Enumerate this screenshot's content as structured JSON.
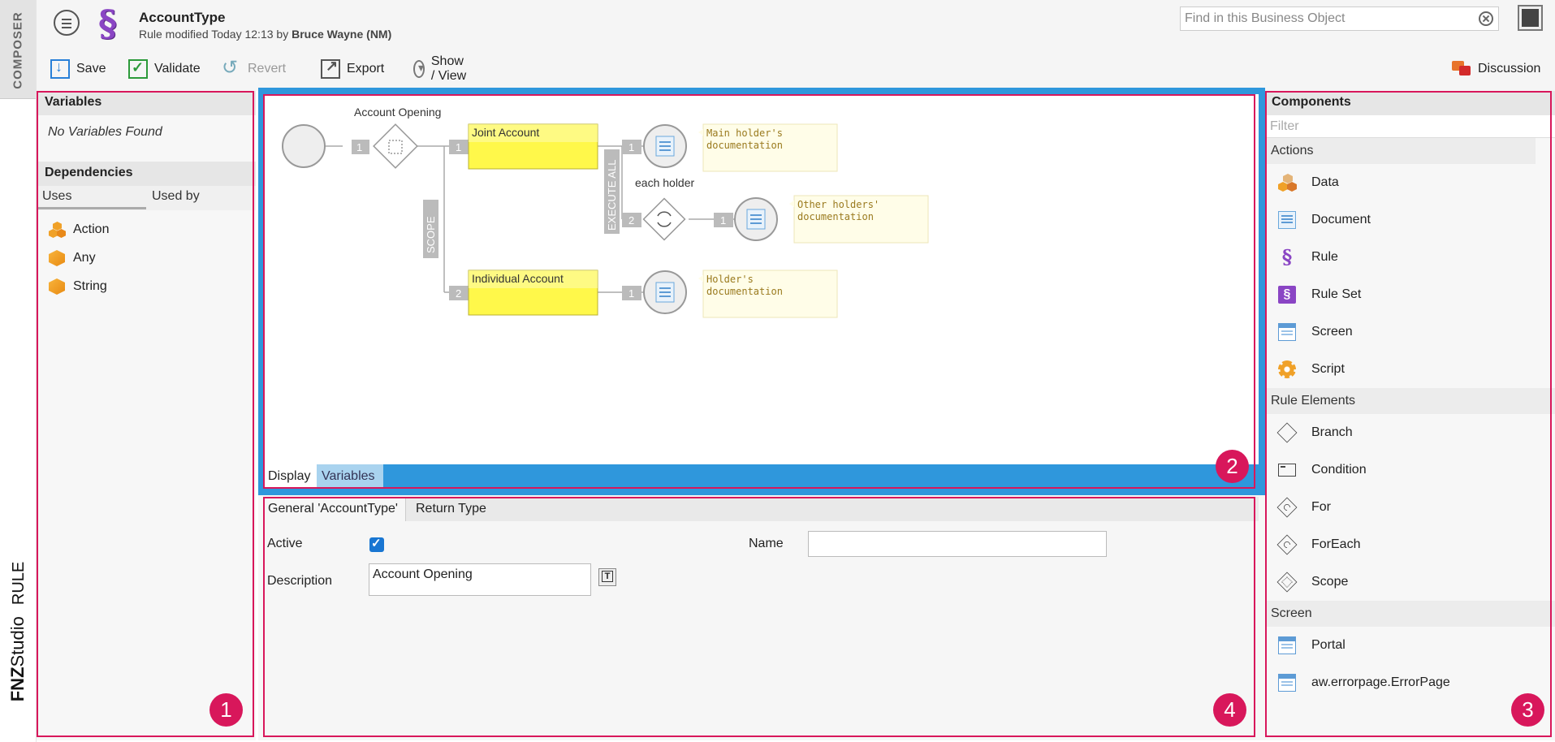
{
  "sidebar_strip": {
    "composer_label": "COMPOSER",
    "brand_fnz": "FNZ",
    "brand_studio": "Studio",
    "brand_rule": "RULE"
  },
  "header": {
    "title": "AccountType",
    "modified_prefix": "Rule modified Today 12:13 by ",
    "modified_by": "Bruce Wayne (NM)",
    "search_placeholder": "Find in this Business Object"
  },
  "toolbar": {
    "save": "Save",
    "validate": "Validate",
    "revert": "Revert",
    "export": "Export",
    "show_view": "Show / View",
    "discussion": "Discussion"
  },
  "left_panel": {
    "variables_title": "Variables",
    "no_variables": "No Variables Found",
    "dependencies_title": "Dependencies",
    "tab_uses": "Uses",
    "tab_used_by": "Used by",
    "dependencies": [
      {
        "label": "Action",
        "icon": "action-cubes-icon"
      },
      {
        "label": "Any",
        "icon": "cube-icon"
      },
      {
        "label": "String",
        "icon": "cube-icon"
      }
    ],
    "badge": "1"
  },
  "canvas": {
    "tab_display": "Display",
    "tab_variables": "Variables",
    "badge": "2",
    "diagram": {
      "branch_label": "Account Opening",
      "scope_label": "SCOPE",
      "execute_all_label": "EXECUTE ALL",
      "foreach_label": "each holder",
      "joint_account": "Joint Account",
      "individual_account": "Individual Account",
      "note_main_1": "Main holder's",
      "note_main_2": "documentation",
      "note_other_1": "Other holders'",
      "note_other_2": "documentation",
      "note_holder_1": "Holder's",
      "note_holder_2": "documentation",
      "n1": "1",
      "n2": "2"
    }
  },
  "properties": {
    "tab_general": "General 'AccountType'",
    "tab_return": "Return Type",
    "active_label": "Active",
    "active_checked": true,
    "name_label": "Name",
    "name_value": "",
    "description_label": "Description",
    "description_value": "Account Opening",
    "badge": "4"
  },
  "right_panel": {
    "title": "Components",
    "filter_placeholder": "Filter",
    "groups": [
      {
        "name": "Actions",
        "items": [
          {
            "label": "Data",
            "icon": "data-icon"
          },
          {
            "label": "Document",
            "icon": "document-icon"
          },
          {
            "label": "Rule",
            "icon": "rule-icon"
          },
          {
            "label": "Rule Set",
            "icon": "rule-set-icon"
          },
          {
            "label": "Screen",
            "icon": "screen-icon"
          },
          {
            "label": "Script",
            "icon": "script-icon"
          }
        ]
      },
      {
        "name": "Rule Elements",
        "items": [
          {
            "label": "Branch",
            "icon": "branch-icon"
          },
          {
            "label": "Condition",
            "icon": "condition-icon"
          },
          {
            "label": "For",
            "icon": "for-icon"
          },
          {
            "label": "ForEach",
            "icon": "foreach-icon"
          },
          {
            "label": "Scope",
            "icon": "scope-icon"
          }
        ]
      },
      {
        "name": "Screen",
        "items": [
          {
            "label": "Portal",
            "icon": "screen-icon"
          },
          {
            "label": "aw.errorpage.ErrorPage",
            "icon": "screen-icon"
          }
        ]
      }
    ],
    "badge": "3"
  },
  "colors": {
    "accent_magenta": "#d8175b",
    "canvas_blue": "#2f97dc",
    "rule_purple": "#8a45c4"
  }
}
